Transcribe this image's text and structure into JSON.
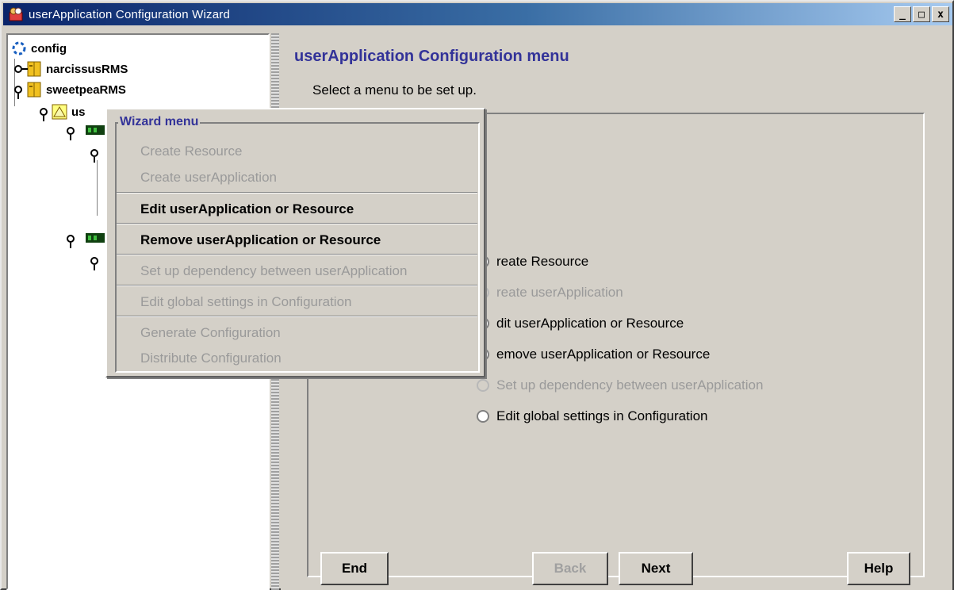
{
  "window": {
    "title": "userApplication Configuration Wizard",
    "controls": {
      "minimize": "_",
      "maximize": "□",
      "close": "x"
    },
    "accent_title_gradient": [
      "#0a246a",
      "#a6caf0"
    ]
  },
  "tree": {
    "root": {
      "label": "config",
      "icon": "config-icon"
    },
    "nodes": [
      {
        "label": "narcissusRMS",
        "icon": "server-icon"
      },
      {
        "label": "sweetpeaRMS",
        "icon": "server-icon"
      },
      {
        "label": "us",
        "icon": "userapplication-warning-icon"
      }
    ]
  },
  "main": {
    "heading": "userApplication Configuration menu",
    "instruction": "Select a menu to be set up.",
    "options": [
      {
        "label": "reate Resource",
        "enabled": true
      },
      {
        "label": "reate userApplication",
        "enabled": false
      },
      {
        "label": "dit userApplication or Resource",
        "enabled": true
      },
      {
        "label": "emove userApplication or Resource",
        "enabled": true
      },
      {
        "label": "Set up dependency between userApplication",
        "enabled": false
      },
      {
        "label": "Edit global settings in Configuration",
        "enabled": true
      }
    ],
    "buttons": {
      "end": "End",
      "back": "Back",
      "next": "Next",
      "help": "Help"
    }
  },
  "popup": {
    "title": "Wizard menu",
    "items": [
      {
        "label": "Create Resource",
        "enabled": false
      },
      {
        "label": "Create userApplication",
        "enabled": false
      },
      {
        "label": "Edit userApplication or Resource",
        "enabled": true
      },
      {
        "label": "Remove userApplication or Resource",
        "enabled": true
      },
      {
        "label": "Set up dependency between userApplication",
        "enabled": false
      },
      {
        "label": "Edit global settings in Configuration",
        "enabled": false
      },
      {
        "label": "Generate Configuration",
        "enabled": false
      },
      {
        "label": "Distribute Configuration",
        "enabled": false
      }
    ]
  }
}
